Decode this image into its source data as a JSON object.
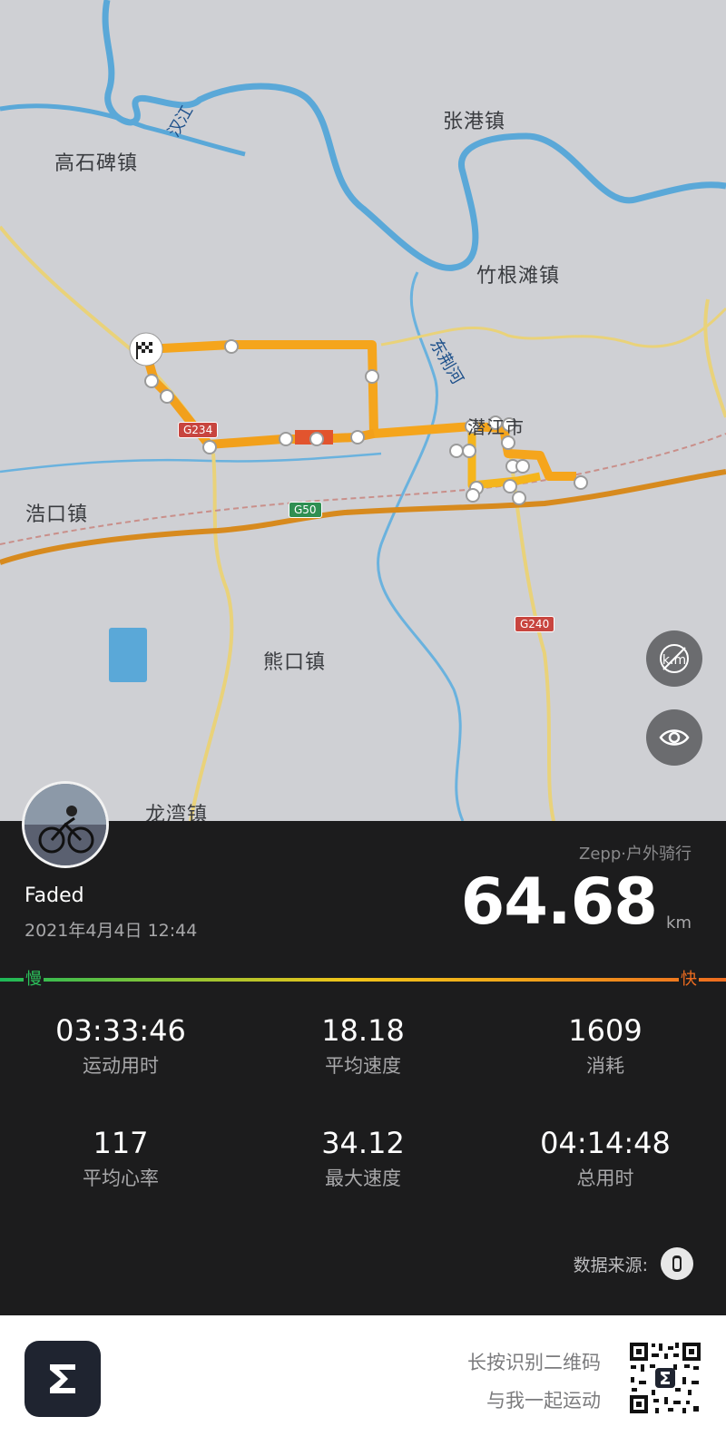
{
  "map": {
    "towns": [
      "高石碑镇",
      "张港镇",
      "竹根滩镇",
      "浩口镇",
      "熊口镇",
      "潜江市",
      "龙湾镇"
    ],
    "rivers": [
      "汉江",
      "东荆河"
    ],
    "roads": [
      "G234",
      "G50",
      "G240"
    ],
    "buttons": {
      "km_toggle": "km-marker-off-icon",
      "visibility": "eye-icon"
    },
    "route_colors": {
      "slow": "#f5b51c",
      "fast": "#ee6c1f"
    }
  },
  "activity": {
    "source": "Zepp·户外骑行",
    "user_name": "Faded",
    "datetime": "2021年4月4日 12:44",
    "distance": "64.68",
    "distance_unit": "km",
    "speed_scale": {
      "slow": "慢",
      "fast": "快"
    }
  },
  "stats": [
    {
      "value": "03:33:46",
      "label": "运动用时"
    },
    {
      "value": "18.18",
      "label": "平均速度"
    },
    {
      "value": "1609",
      "label": "消耗"
    },
    {
      "value": "117",
      "label": "平均心率"
    },
    {
      "value": "34.12",
      "label": "最大速度"
    },
    {
      "value": "04:14:48",
      "label": "总用时"
    }
  ],
  "data_source_label": "数据来源:",
  "footer": {
    "promo_line1": "长按识别二维码",
    "promo_line2": "与我一起运动",
    "app_icon": "zepp-sigma-logo",
    "qr_icon": "qr-code-icon"
  }
}
